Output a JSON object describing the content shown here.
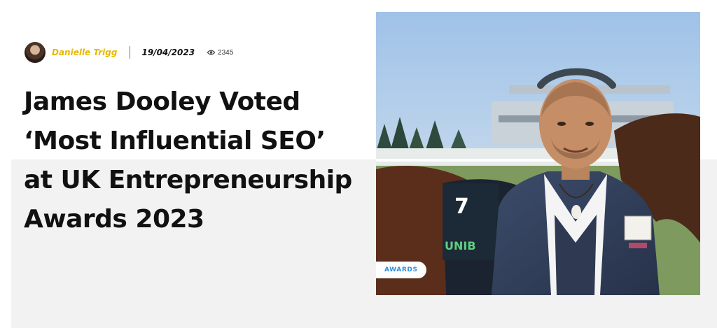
{
  "post": {
    "author": "Danielle Trigg",
    "date": "19/04/2023",
    "views": "2345",
    "title": "James Dooley Voted ‘Most Influential SEO’ at UK Entrepreneurship Awards 2023",
    "category": "AWARDS"
  },
  "hero_image": {
    "saddle_cloth_number": "7",
    "saddle_cloth_text": "UNIB"
  },
  "colors": {
    "author": "#e8b800",
    "badge_text": "#2f8fd8",
    "band": "#f2f2f2"
  },
  "icons": {
    "views": "eye-icon",
    "author": "avatar"
  }
}
